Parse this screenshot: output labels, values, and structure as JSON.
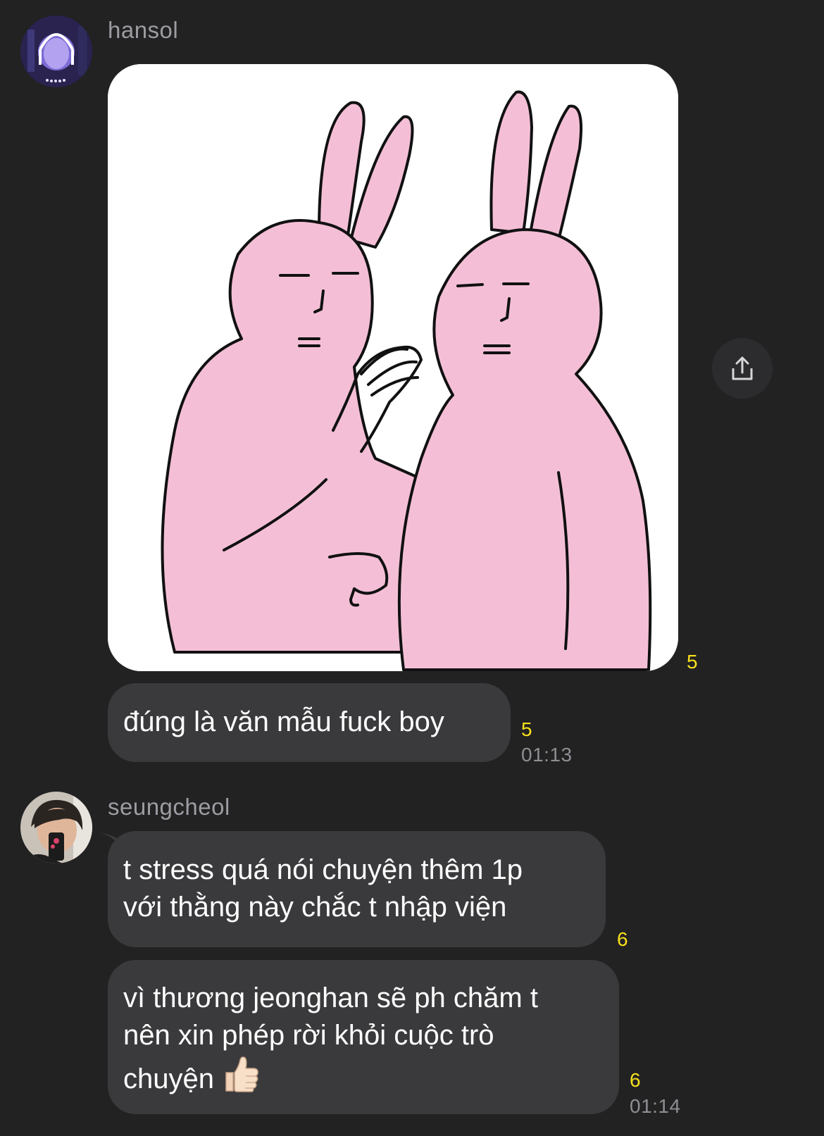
{
  "messages": [
    {
      "sender": "hansol",
      "avatar_icon": "avatar-hansol",
      "image_icon": "pink-rabbits-whispering-sticker",
      "image_unread": "5",
      "text_lines": [
        "đúng là văn mẫu fuck boy"
      ],
      "text_unread": "5",
      "time": "01:13"
    },
    {
      "sender": "seungcheol",
      "avatar_icon": "avatar-seungcheol",
      "bubbles": [
        {
          "lines": [
            "t stress quá nói chuyện thêm 1p",
            "với thằng này chắc t nhập viện"
          ],
          "unread": "6"
        },
        {
          "lines": [
            "vì thương jeonghan sẽ ph chăm t",
            "nên xin phép rời khỏi cuộc trò",
            "chuyện"
          ],
          "emoji": "thumbs-up",
          "unread": "6",
          "time": "01:14"
        }
      ]
    }
  ],
  "share_icon": "share-icon",
  "colors": {
    "background": "#222223",
    "bubble": "#3a3a3c",
    "unread": "#f7e01b",
    "time": "#8e8e93"
  }
}
